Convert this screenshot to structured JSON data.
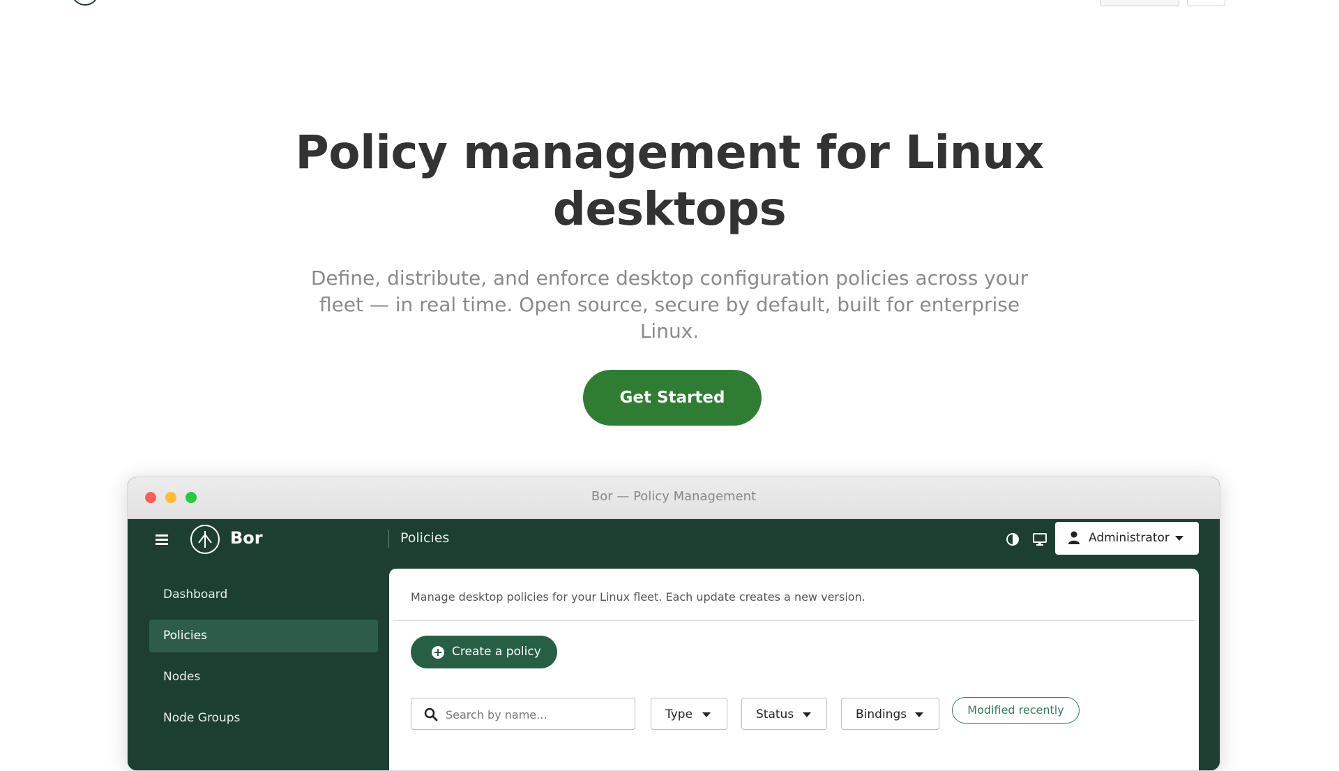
{
  "hero": {
    "title": "Policy management for Linux desktops",
    "subtitle": "Define, distribute, and enforce desktop configuration policies across your fleet — in real time. Open source, secure by default, built for enterprise Linux.",
    "cta_label": "Get Started"
  },
  "window": {
    "title": "Bor — Policy Management"
  },
  "app": {
    "brand": "Bor",
    "section": "Policies",
    "user_label": "Administrator",
    "icons": {
      "menu": "hamburger-icon",
      "theme": "contrast-icon",
      "display": "monitor-icon",
      "user": "user-icon"
    }
  },
  "sidebar": {
    "items": [
      {
        "label": "Dashboard",
        "active": false
      },
      {
        "label": "Policies",
        "active": true
      },
      {
        "label": "Nodes",
        "active": false
      },
      {
        "label": "Node Groups",
        "active": false
      }
    ]
  },
  "content": {
    "description": "Manage desktop policies for your Linux fleet. Each update creates a new version.",
    "create_label": "Create a policy",
    "search_placeholder": "Search by name...",
    "filters": [
      "Type",
      "Status",
      "Bindings"
    ],
    "chip_label": "Modified recently"
  },
  "colors": {
    "brand_dark": "#1c3f32",
    "primary_green": "#2e7d32",
    "active_nav": "#2d5d48",
    "button_green": "#275f45"
  }
}
